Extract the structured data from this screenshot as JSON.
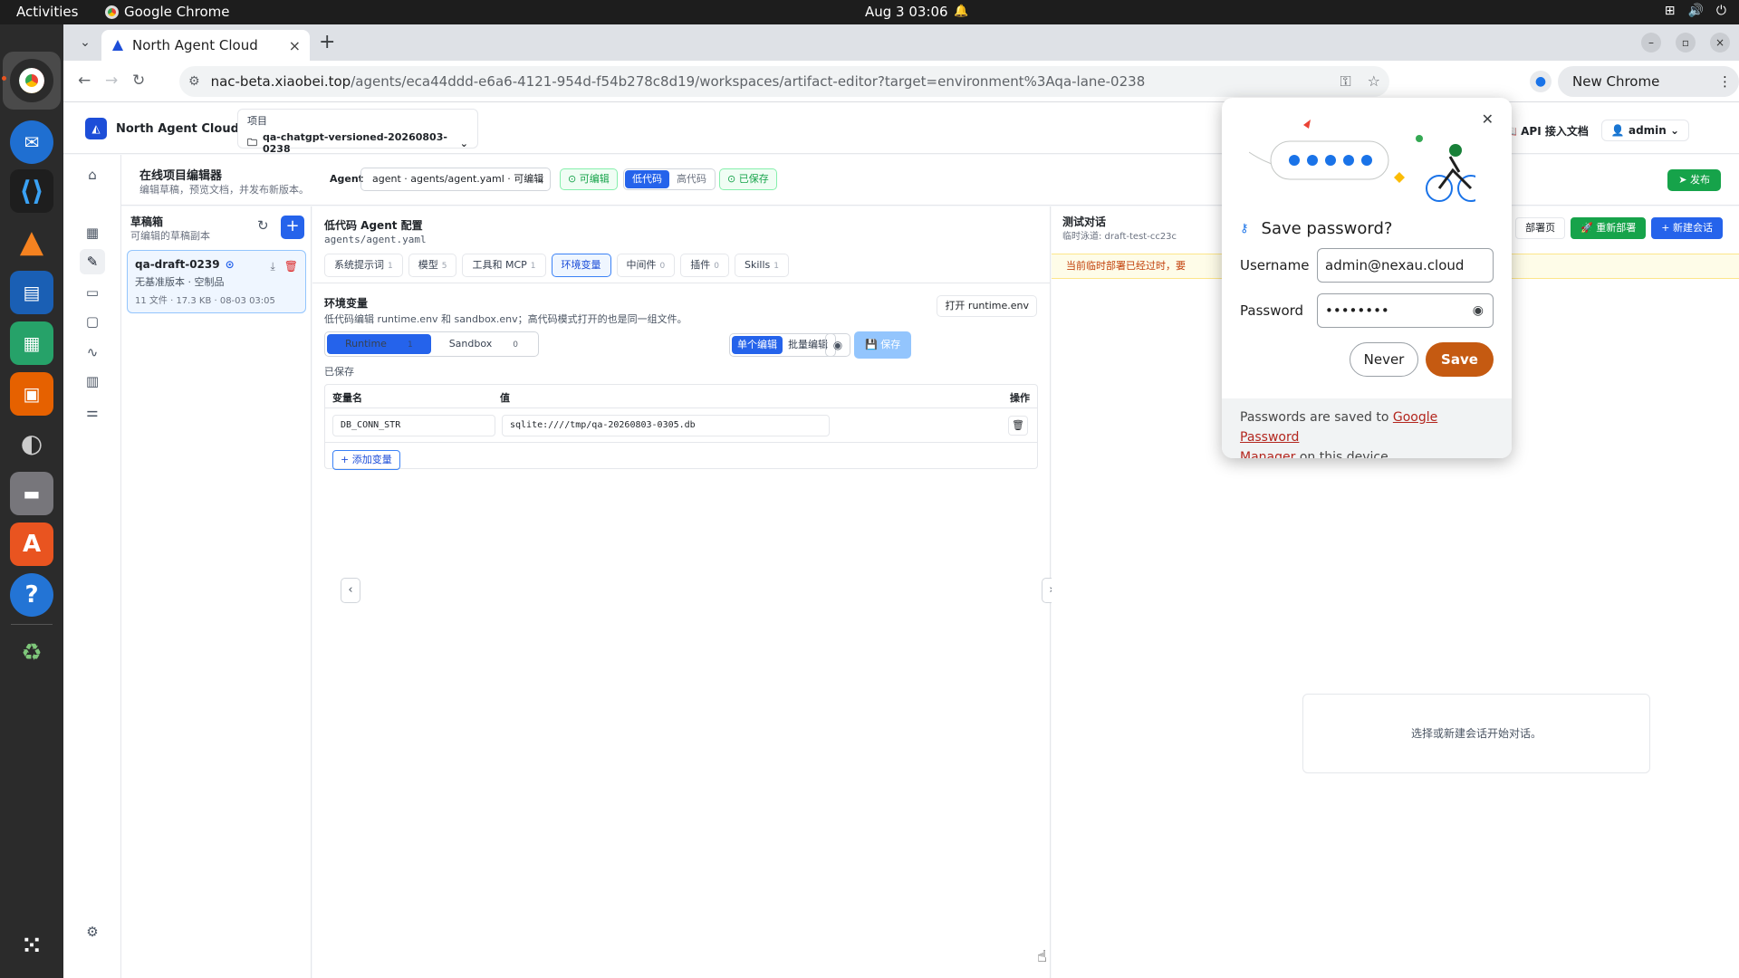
{
  "os": {
    "activities": "Activities",
    "app_name": "Google Chrome",
    "clock": "Aug 3  03:06"
  },
  "browser": {
    "tab_title": "North Agent Cloud",
    "url_host": "nac-beta.xiaobei.top",
    "url_path": "/agents/eca44ddd-e6a6-4121-954d-f54b278c8d19/workspaces/artifact-editor?target=environment%3Aqa-lane-0238",
    "update_label": "New Chrome available"
  },
  "app": {
    "brand": "North Agent Cloud",
    "project_label": "项目",
    "project_name": "qa-chatgpt-versioned-20260803-0238",
    "api_docs": "API 接入文档",
    "user": "admin"
  },
  "editor_bar": {
    "title": "在线项目编辑器",
    "subtitle": "编辑草稿，预览文档，并发布新版本。",
    "agent_label": "Agent",
    "agent_select": "agent · agents/agent.yaml · 可编辑",
    "editable_badge": "可编辑",
    "mode_low": "低代码",
    "mode_high": "高代码",
    "saved_badge": "已保存",
    "publish": "发布"
  },
  "drafts": {
    "title": "草稿箱",
    "subtitle": "可编辑的草稿副本",
    "card": {
      "name": "qa-draft-0239",
      "meta": "无基准版本 · 空制品",
      "stats": "11 文件 · 17.3 KB · 08-03 03:05"
    }
  },
  "config": {
    "title": "低代码 Agent 配置",
    "path": "agents/agent.yaml",
    "tabs": [
      {
        "label": "系统提示词",
        "count": "1"
      },
      {
        "label": "模型",
        "count": "5"
      },
      {
        "label": "工具和 MCP",
        "count": "1"
      },
      {
        "label": "环境变量",
        "count": ""
      },
      {
        "label": "中间件",
        "count": "0"
      },
      {
        "label": "插件",
        "count": "0"
      },
      {
        "label": "Skills",
        "count": "1"
      }
    ],
    "env_title": "环境变量",
    "env_sub": "低代码编辑 runtime.env 和 sandbox.env；高代码模式打开的也是同一组文件。",
    "open_runtime": "打开 runtime.env",
    "runtime_tab": "Runtime",
    "runtime_count": "1",
    "sandbox_tab": "Sandbox",
    "sandbox_count": "0",
    "single_edit": "单个编辑",
    "batch_edit": "批量编辑",
    "save": "保存",
    "saved_status": "已保存",
    "col_name": "变量名",
    "col_value": "值",
    "col_ops": "操作",
    "row_name": "DB_CONN_STR",
    "row_value": "sqlite:////tmp/qa-20260803-0305.db",
    "add_var": "添加变量"
  },
  "chat": {
    "title": "测试对话",
    "sub": "临时泳道: draft-test-cc23c",
    "deploy_page": "部署页",
    "redeploy": "重新部署",
    "new_session": "新建会话",
    "warning": "当前临时部署已经过时，要",
    "empty": "选择或新建会话开始对话。"
  },
  "password_popup": {
    "title": "Save password?",
    "username_label": "Username",
    "username_value": "admin@nexau.cloud",
    "password_label": "Password",
    "password_value": "••••••••",
    "never": "Never",
    "save": "Save",
    "footer_pre": "Passwords are saved to ",
    "footer_link1": "Google Password",
    "footer_link2": "Manager",
    "footer_post": " on this device."
  }
}
